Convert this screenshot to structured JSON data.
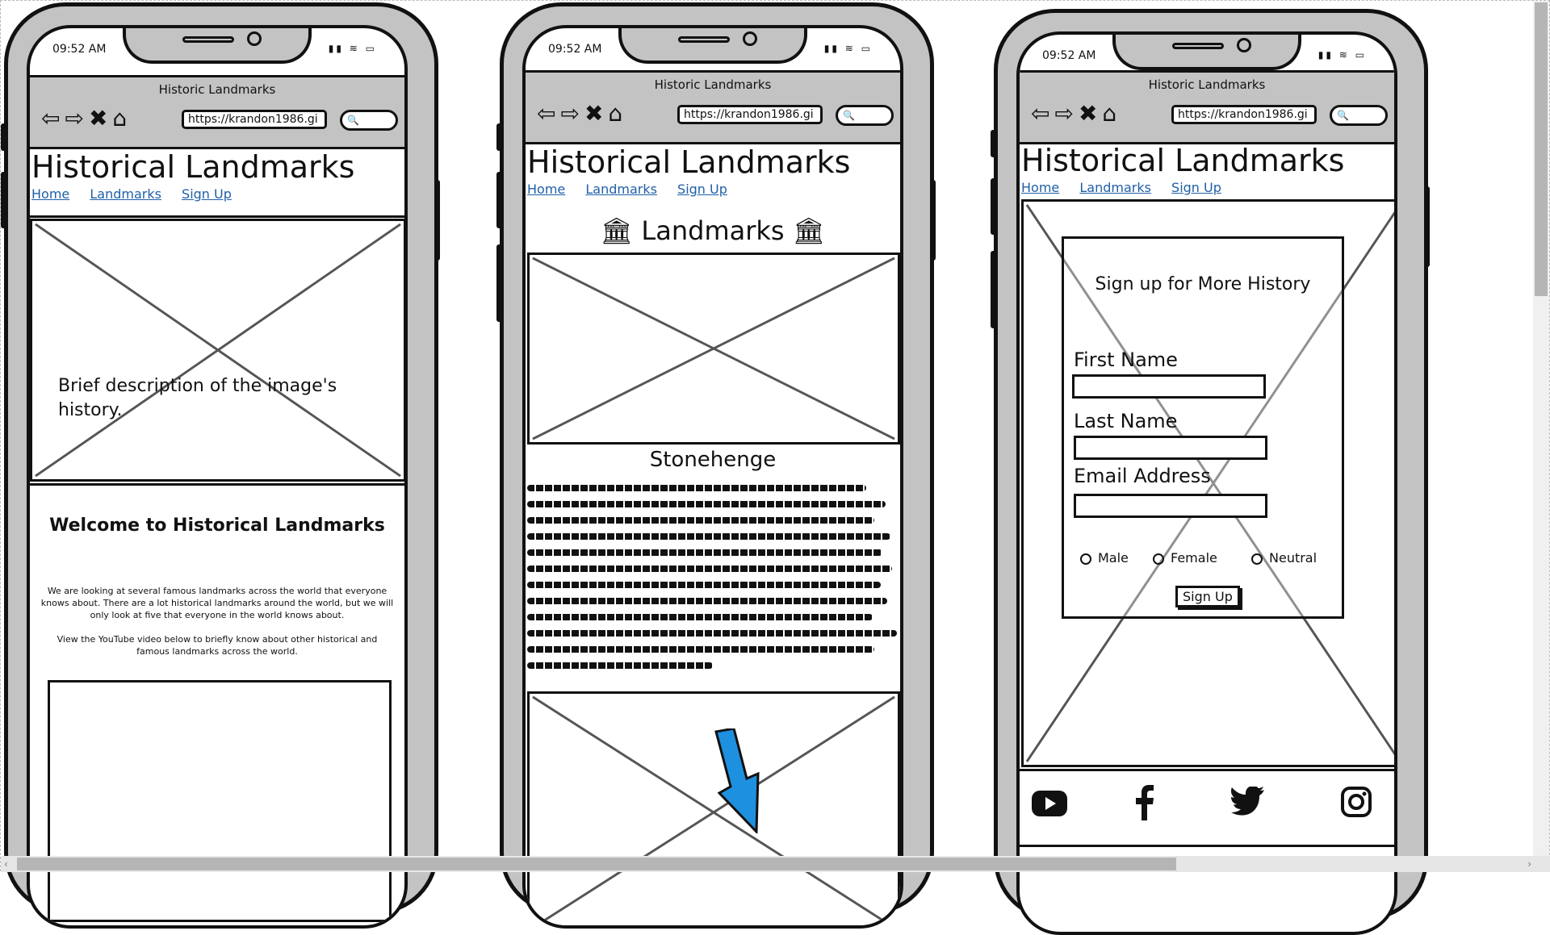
{
  "device": {
    "time": "09:52 AM",
    "status_icons": "▮▮ ≋ ▭",
    "browser_title": "Historic Landmarks",
    "url": "https://krandon1986.gi",
    "nav_icons": [
      "back-arrow-icon",
      "forward-arrow-icon",
      "close-icon",
      "home-icon"
    ]
  },
  "site": {
    "title": "Historical Landmarks",
    "nav": [
      "Home",
      "Landmarks",
      "Sign Up"
    ]
  },
  "home": {
    "image_caption": "Brief description of the image's history.",
    "welcome_heading": "Welcome to Historical Landmarks",
    "paragraph1": "We are looking at several famous landmarks across the world that everyone knows about. There are a lot historical landmarks around the world, but we will only look at five that everyone in the world knows about.",
    "paragraph2": "View the YouTube video below to briefly know about other historical and famous landmarks across the world."
  },
  "landmarks": {
    "heading": "🏛 Landmarks 🏛",
    "landmark_name": "Stonehenge"
  },
  "signup": {
    "heading": "Sign up for More History",
    "first_name_label": "First Name",
    "last_name_label": "Last Name",
    "email_label": "Email Address",
    "gender_options": [
      "Male",
      "Female",
      "Neutral"
    ],
    "submit_label": "Sign Up",
    "social_icons": [
      "youtube-icon",
      "facebook-icon",
      "twitter-icon",
      "instagram-icon"
    ]
  },
  "colors": {
    "phone_gray": "#c3c3c3",
    "link_blue": "#1f5fa8",
    "arrow_blue": "#1e90e0"
  }
}
